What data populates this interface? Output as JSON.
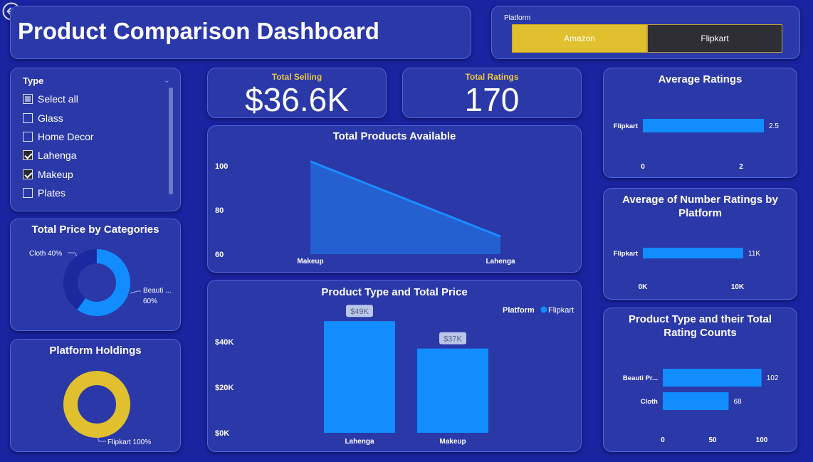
{
  "header": {
    "title": "Product Comparison Dashboard"
  },
  "platform_slicer": {
    "label": "Platform",
    "options": [
      "Amazon",
      "Flipkart"
    ],
    "selected": "Amazon"
  },
  "type_slicer": {
    "label": "Type",
    "items": [
      {
        "label": "Select all",
        "state": "partial"
      },
      {
        "label": "Glass",
        "state": "unchecked"
      },
      {
        "label": "Home Decor",
        "state": "unchecked"
      },
      {
        "label": "Lahenga",
        "state": "checked"
      },
      {
        "label": "Makeup",
        "state": "checked"
      },
      {
        "label": "Plates",
        "state": "unchecked"
      }
    ]
  },
  "kpis": {
    "total_selling": {
      "label": "Total Selling",
      "value": "$36.6K"
    },
    "total_ratings": {
      "label": "Total Ratings",
      "value": "170"
    }
  },
  "colors": {
    "background": "#1a23a0",
    "card": "#2b38a8",
    "card_border": "#4d66e0",
    "bar_blue": "#118dff",
    "area_fill": "#2460d0",
    "donut_dark": "#1a2a9e",
    "gold": "#e0c02e",
    "kpi_label": "#e8c84a"
  },
  "chart_data": [
    {
      "id": "total-products",
      "type": "area",
      "title": "Total Products Available",
      "categories": [
        "Makeup",
        "Lahenga"
      ],
      "values": [
        102,
        68
      ],
      "yticks": [
        "60",
        "80",
        "100"
      ],
      "ylim": [
        60,
        100
      ]
    },
    {
      "id": "product-type-price",
      "type": "bar",
      "title": "Product Type and Total Price",
      "legend_title": "Platform",
      "legend": [
        "Flipkart"
      ],
      "legend_position": "top-right",
      "categories": [
        "Lahenga",
        "Makeup"
      ],
      "values": [
        49000,
        37000
      ],
      "data_labels": [
        "$49K",
        "$37K"
      ],
      "yticks": [
        "$0K",
        "$20K",
        "$40K"
      ],
      "ylim": [
        0,
        50000
      ]
    },
    {
      "id": "price-categories",
      "type": "pie",
      "title": "Total Price by Categories",
      "slices": [
        {
          "label": "Cloth 40%",
          "value": 40
        },
        {
          "label": "Beauti ...",
          "pct": "60%",
          "value": 60
        }
      ]
    },
    {
      "id": "platform-holdings",
      "type": "pie",
      "title": "Platform Holdings",
      "slices": [
        {
          "label": "Flipkart 100%",
          "value": 100
        }
      ]
    },
    {
      "id": "avg-ratings",
      "type": "bar",
      "orientation": "horizontal",
      "title": "Average Ratings",
      "categories": [
        "Flipkart"
      ],
      "values": [
        2.5
      ],
      "data_labels": [
        "2.5"
      ],
      "xticks": [
        "0",
        "2"
      ],
      "xlim": [
        0,
        2.5
      ]
    },
    {
      "id": "avg-number-ratings",
      "type": "bar",
      "orientation": "horizontal",
      "title": "Average of Number Ratings by Platform",
      "categories": [
        "Flipkart"
      ],
      "values": [
        11000
      ],
      "data_labels": [
        "11K"
      ],
      "xticks": [
        "0K",
        "10K"
      ],
      "xlim": [
        0,
        11000
      ]
    },
    {
      "id": "type-rating-counts",
      "type": "bar",
      "orientation": "horizontal",
      "title": "Product Type and their Total Rating Counts",
      "categories": [
        "Beauti Pr...",
        "Cloth"
      ],
      "values": [
        102,
        68
      ],
      "data_labels": [
        "102",
        "68"
      ],
      "xticks": [
        "0",
        "50",
        "100"
      ],
      "xlim": [
        0,
        100
      ]
    }
  ]
}
